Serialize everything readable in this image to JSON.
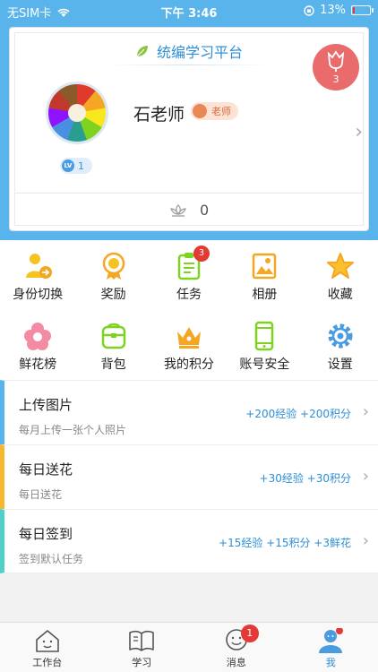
{
  "status_bar": {
    "carrier": "无SIM卡",
    "time": "下午 3:46",
    "battery": "13%",
    "battery_level": 0.13
  },
  "profile_card": {
    "platform_title": "统编学习平台",
    "flower_count": "3",
    "user_name": "石老师",
    "role": "老师",
    "level_badge": "LV",
    "level": "1",
    "like_count": "0"
  },
  "grid_menu": [
    {
      "label": "身份切换",
      "icon": "switch-identity-icon"
    },
    {
      "label": "奖励",
      "icon": "reward-medal-icon"
    },
    {
      "label": "任务",
      "icon": "task-clipboard-icon",
      "badge": "3"
    },
    {
      "label": "相册",
      "icon": "photo-album-icon"
    },
    {
      "label": "收藏",
      "icon": "star-icon"
    },
    {
      "label": "鲜花榜",
      "icon": "flower-icon"
    },
    {
      "label": "背包",
      "icon": "backpack-icon"
    },
    {
      "label": "我的积分",
      "icon": "crown-icon"
    },
    {
      "label": "账号安全",
      "icon": "phone-icon"
    },
    {
      "label": "设置",
      "icon": "gear-icon"
    }
  ],
  "tasks": [
    {
      "title": "上传图片",
      "subtitle": "每月上传一张个人照片",
      "reward": "+200经验 +200积分",
      "accent": "#5ab4ec"
    },
    {
      "title": "每日送花",
      "subtitle": "每日送花",
      "reward": "+30经验 +30积分",
      "accent": "#f5b82e"
    },
    {
      "title": "每日签到",
      "subtitle": "签到默认任务",
      "reward": "+15经验 +15积分 +3鲜花",
      "accent": "#4fd0c8"
    }
  ],
  "tab_bar": [
    {
      "label": "工作台",
      "icon": "home-icon"
    },
    {
      "label": "学习",
      "icon": "book-icon"
    },
    {
      "label": "消息",
      "icon": "chat-icon",
      "badge": "1"
    },
    {
      "label": "我",
      "icon": "profile-icon",
      "active": true
    }
  ],
  "colors": {
    "accent_blue": "#5ab4ec",
    "link_blue": "#2d8fd6",
    "badge_red": "#e53935"
  }
}
